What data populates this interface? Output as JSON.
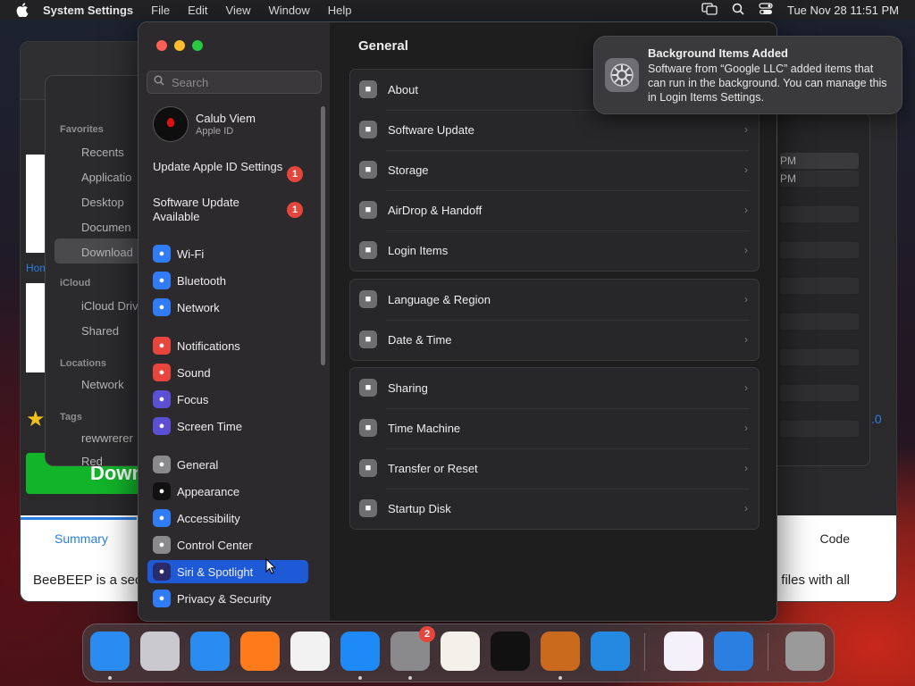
{
  "menubar": {
    "app_name": "System Settings",
    "menus": [
      "File",
      "Edit",
      "View",
      "Window",
      "Help"
    ],
    "datetime": "Tue Nov 28  11:51 PM"
  },
  "background": {
    "finder_favorites": "Favorites",
    "finder_items": [
      "Recents",
      "Applicatio",
      "Desktop",
      "Documen",
      "Download"
    ],
    "finder_icloud": "iCloud",
    "finder_icloud_items": [
      "iCloud Driv",
      "Shared"
    ],
    "finder_locations": "Locations",
    "finder_location_items": [
      "Network"
    ],
    "finder_tags": "Tags",
    "finder_tag_items": [
      "rewwrerer",
      "Red"
    ],
    "browser_home": "Hom",
    "browser_download": "Down",
    "browser_tab_summary": "Summary",
    "browser_tab_code": "Code",
    "browser_text_left": "BeeBEEP is a sec",
    "browser_text_right": "files with all",
    "rightwin_rows": [
      "PM",
      "PM"
    ],
    "rightwin_extra": ".0"
  },
  "settings": {
    "search_placeholder": "Search",
    "account": {
      "name": "Calub Viem",
      "sub": "Apple ID"
    },
    "notices": [
      {
        "label": "Update Apple ID Settings",
        "badge": "1"
      },
      {
        "label": "Software Update Available",
        "badge": "1"
      }
    ],
    "sidebar_groups": [
      [
        {
          "label": "Wi-Fi",
          "icon": "wifi-icon",
          "color": "#2f7cf6"
        },
        {
          "label": "Bluetooth",
          "icon": "bluetooth-icon",
          "color": "#2f7cf6"
        },
        {
          "label": "Network",
          "icon": "globe-icon",
          "color": "#2f7cf6"
        }
      ],
      [
        {
          "label": "Notifications",
          "icon": "bell-icon",
          "color": "#e8453c"
        },
        {
          "label": "Sound",
          "icon": "speaker-icon",
          "color": "#e8453c"
        },
        {
          "label": "Focus",
          "icon": "moon-icon",
          "color": "#5b4fd4"
        },
        {
          "label": "Screen Time",
          "icon": "hourglass-icon",
          "color": "#5b4fd4"
        }
      ],
      [
        {
          "label": "General",
          "icon": "gear-icon",
          "color": "#8a898c"
        },
        {
          "label": "Appearance",
          "icon": "appearance-icon",
          "color": "#111111"
        },
        {
          "label": "Accessibility",
          "icon": "accessibility-icon",
          "color": "#2f7cf6"
        },
        {
          "label": "Control Center",
          "icon": "toggles-icon",
          "color": "#8a898c"
        },
        {
          "label": "Siri & Spotlight",
          "icon": "siri-icon",
          "color": "#2b2b6b",
          "selected": true
        },
        {
          "label": "Privacy & Security",
          "icon": "hand-icon",
          "color": "#2f7cf6"
        }
      ]
    ],
    "content_title": "General",
    "groups": [
      [
        {
          "label": "About",
          "icon": "computer-icon"
        },
        {
          "label": "Software Update",
          "icon": "gear-badge-icon"
        },
        {
          "label": "Storage",
          "icon": "drive-icon"
        },
        {
          "label": "AirDrop & Handoff",
          "icon": "airdrop-icon"
        },
        {
          "label": "Login Items",
          "icon": "list-icon"
        }
      ],
      [
        {
          "label": "Language & Region",
          "icon": "globe-icon"
        },
        {
          "label": "Date & Time",
          "icon": "calendar-icon"
        }
      ],
      [
        {
          "label": "Sharing",
          "icon": "sharing-icon"
        },
        {
          "label": "Time Machine",
          "icon": "time-machine-icon"
        },
        {
          "label": "Transfer or Reset",
          "icon": "reset-icon"
        },
        {
          "label": "Startup Disk",
          "icon": "disk-icon"
        }
      ]
    ]
  },
  "notification": {
    "title": "Background Items Added",
    "body": "Software from “Google LLC” added items that can run in the background. You can manage this in Login Items Settings."
  },
  "dock": {
    "apps": [
      {
        "name": "finder-icon",
        "color": "#2a8cf0"
      },
      {
        "name": "launchpad-icon",
        "color": "#c9c9cf"
      },
      {
        "name": "safari-icon",
        "color": "#2a8cf0"
      },
      {
        "name": "firefox-icon",
        "color": "#ff7a1a"
      },
      {
        "name": "chrome-icon",
        "color": "#f2f2f2"
      },
      {
        "name": "app-store-icon",
        "color": "#1d8af5"
      },
      {
        "name": "system-settings-icon",
        "color": "#8a898c",
        "badge": "2"
      },
      {
        "name": "textedit-icon",
        "color": "#f3f1ea"
      },
      {
        "name": "terminal-icon",
        "color": "#111111"
      },
      {
        "name": "garageband-icon",
        "color": "#c96a1c"
      },
      {
        "name": "vscode-icon",
        "color": "#2489e0"
      },
      {
        "name": "visual-studio-icon",
        "color": "#f4f1fb"
      },
      {
        "name": "weather-icon",
        "color": "#2a7fe0"
      },
      {
        "name": "trash-icon",
        "color": "#9a9a9a"
      }
    ]
  }
}
